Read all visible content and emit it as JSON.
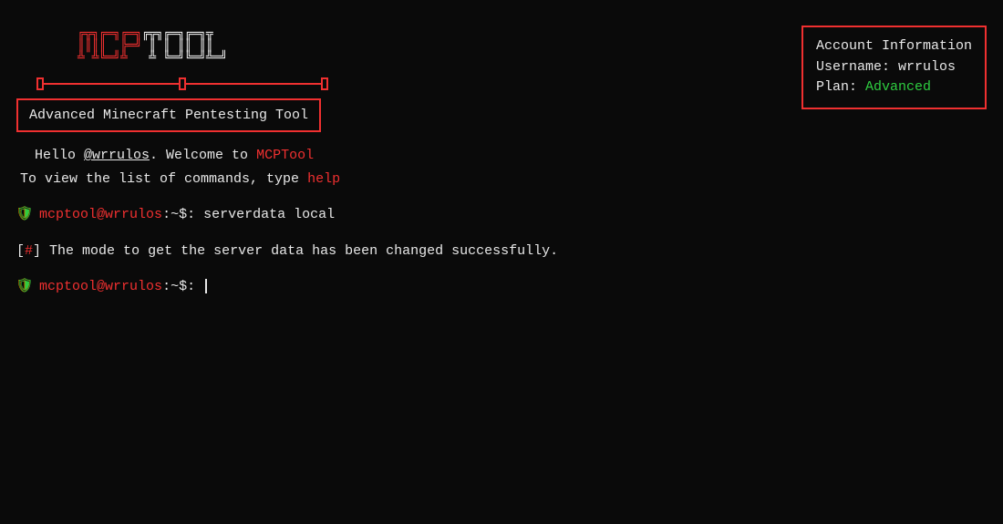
{
  "logo": {
    "part1": "MCP",
    "part2": "T",
    "part3": "OOL"
  },
  "subtitle": "Advanced Minecraft Pentesting Tool",
  "account": {
    "heading": "Account Information",
    "username_label": "Username:",
    "username_value": "wrrulos",
    "plan_label": "Plan:",
    "plan_value": "Advanced"
  },
  "welcome": {
    "hello_prefix": "Hello ",
    "handle": "@wrrulos",
    "hello_suffix": ". Welcome to ",
    "tool_name": "MCPTool",
    "hint_prefix": "To view the list of commands, type ",
    "hint_cmd": "help"
  },
  "prompt": {
    "user": "mcptool",
    "at": "@",
    "host": "wrrulos",
    "path_sep": ":~$:",
    "shield_glyph": "🛡"
  },
  "history": {
    "cmd1": "serverdata local"
  },
  "status": {
    "lbracket": "[",
    "hash": "#",
    "rbracket": "]",
    "message": " The mode to get the server data has been changed successfully."
  }
}
